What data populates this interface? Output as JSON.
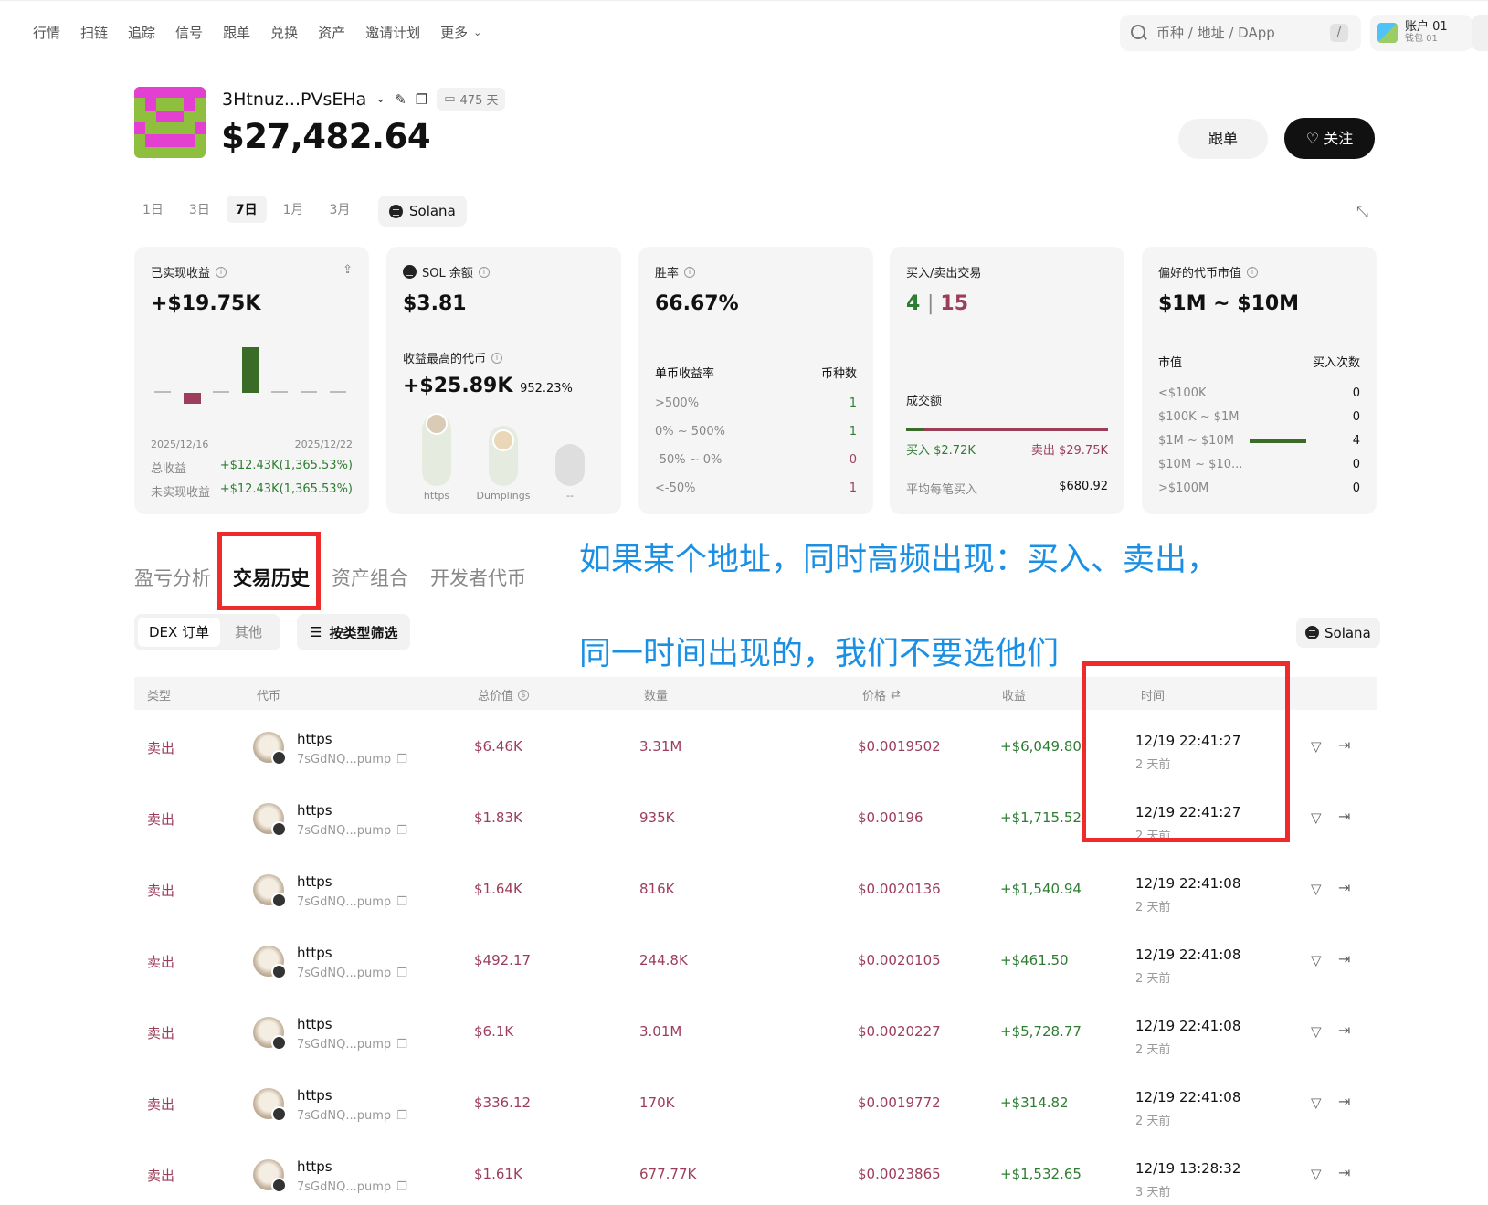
{
  "nav": {
    "items": [
      "行情",
      "扫链",
      "追踪",
      "信号",
      "跟单",
      "兑换",
      "资产",
      "邀请计划"
    ],
    "more": "更多",
    "search_placeholder": "币种 / 地址 / DApp",
    "search_shortcut": "/",
    "account_name": "账户 01",
    "account_sub": "钱包 01"
  },
  "profile": {
    "address": "3Htnuz...PVsEHa",
    "days": "475 天",
    "balance": "$27,482.64",
    "copy_trade_label": "跟单",
    "follow_label": "关注"
  },
  "periods": [
    "1日",
    "3日",
    "7日",
    "1月",
    "3月"
  ],
  "active_period": "7日",
  "chain": "Solana",
  "cards": {
    "realized": {
      "label": "已实现收益",
      "value": "+$19.75K",
      "date_start": "2025/12/16",
      "date_end": "2025/12/22",
      "total_label": "总收益",
      "total_value": "+$12.43K(1,365.53%)",
      "unrealized_label": "未实现收益",
      "unrealized_value": "+$12.43K(1,365.53%)"
    },
    "sol": {
      "label": "SOL 余额",
      "value": "$3.81",
      "top_label": "收益最高的代币",
      "top_value": "+$25.89K",
      "top_pct": "952.23%",
      "tokens": [
        "https",
        "Dumplings",
        "--"
      ]
    },
    "winrate": {
      "label": "胜率",
      "value": "66.67%",
      "col1": "单币收益率",
      "col2": "币种数",
      "rows": [
        {
          "range": ">500%",
          "count": "1"
        },
        {
          "range": "0% ~ 500%",
          "count": "1"
        },
        {
          "range": "-50% ~ 0%",
          "count": "0"
        },
        {
          "range": "<-50%",
          "count": "1"
        }
      ]
    },
    "trades": {
      "label": "买入/卖出交易",
      "buy_count": "4",
      "sell_count": "15",
      "volume_label": "成交额",
      "buy_label": "买入 $2.72K",
      "sell_label": "卖出 $29.75K",
      "avg_label": "平均每笔买入",
      "avg_value": "$680.92"
    },
    "mcap": {
      "label": "偏好的代币市值",
      "value": "$1M ~ $10M",
      "col1": "市值",
      "col2": "买入次数",
      "rows": [
        {
          "range": "<$100K",
          "count": "0"
        },
        {
          "range": "$100K ~ $1M",
          "count": "0"
        },
        {
          "range": "$1M ~ $10M",
          "count": "4"
        },
        {
          "range": "$10M ~ $10...",
          "count": "0"
        },
        {
          "range": ">$100M",
          "count": "0"
        }
      ]
    }
  },
  "annotation": {
    "line1": "如果某个地址，同时高频出现：买入、卖出，",
    "line2": "同一时间出现的，我们不要选他们"
  },
  "section_tabs": [
    "盈亏分析",
    "交易历史",
    "资产组合",
    "开发者代币"
  ],
  "active_section": "交易历史",
  "subtabs": {
    "dex": "DEX 订单",
    "other": "其他",
    "filter": "按类型筛选"
  },
  "table": {
    "headers": {
      "type": "类型",
      "token": "代币",
      "total": "总价值",
      "amount": "数量",
      "price": "价格",
      "pnl": "收益",
      "time": "时间"
    },
    "rows": [
      {
        "type": "卖出",
        "token": "https",
        "addr": "7sGdNQ...pump",
        "total": "$6.46K",
        "amount": "3.31M",
        "price": "$0.0019502",
        "pnl": "+$6,049.80",
        "time": "12/19 22:41:27",
        "ago": "2 天前"
      },
      {
        "type": "卖出",
        "token": "https",
        "addr": "7sGdNQ...pump",
        "total": "$1.83K",
        "amount": "935K",
        "price": "$0.00196",
        "pnl": "+$1,715.52",
        "time": "12/19 22:41:27",
        "ago": "2 天前"
      },
      {
        "type": "卖出",
        "token": "https",
        "addr": "7sGdNQ...pump",
        "total": "$1.64K",
        "amount": "816K",
        "price": "$0.0020136",
        "pnl": "+$1,540.94",
        "time": "12/19 22:41:08",
        "ago": "2 天前"
      },
      {
        "type": "卖出",
        "token": "https",
        "addr": "7sGdNQ...pump",
        "total": "$492.17",
        "amount": "244.8K",
        "price": "$0.0020105",
        "pnl": "+$461.50",
        "time": "12/19 22:41:08",
        "ago": "2 天前"
      },
      {
        "type": "卖出",
        "token": "https",
        "addr": "7sGdNQ...pump",
        "total": "$6.1K",
        "amount": "3.01M",
        "price": "$0.0020227",
        "pnl": "+$5,728.77",
        "time": "12/19 22:41:08",
        "ago": "2 天前"
      },
      {
        "type": "卖出",
        "token": "https",
        "addr": "7sGdNQ...pump",
        "total": "$336.12",
        "amount": "170K",
        "price": "$0.0019772",
        "pnl": "+$314.82",
        "time": "12/19 22:41:08",
        "ago": "2 天前"
      },
      {
        "type": "卖出",
        "token": "https",
        "addr": "7sGdNQ...pump",
        "total": "$1.61K",
        "amount": "677.77K",
        "price": "$0.0023865",
        "pnl": "+$1,532.65",
        "time": "12/19 13:28:32",
        "ago": "3 天前"
      }
    ]
  }
}
